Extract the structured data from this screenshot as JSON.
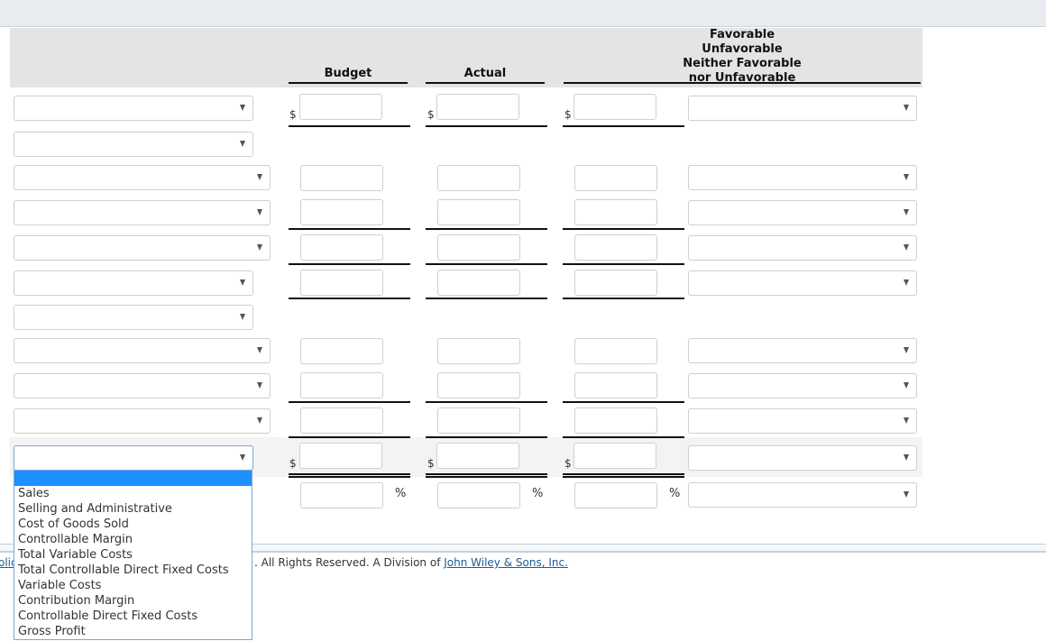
{
  "header": {
    "budget_label": "Budget",
    "actual_label": "Actual",
    "fav_label_lines": [
      "Favorable",
      "Unfavorable",
      "Neither Favorable",
      "nor Unfavorable"
    ]
  },
  "rows": [
    {
      "label_select": "",
      "has_dollar": true,
      "has_amounts": true,
      "fav_select": ""
    },
    {
      "label_select": "",
      "has_dollar": false,
      "has_amounts": false
    },
    {
      "label_select": "",
      "has_dollar": false,
      "has_amounts": true,
      "fav_select": ""
    },
    {
      "label_select": "",
      "has_dollar": false,
      "has_amounts": true,
      "fav_select": ""
    },
    {
      "label_select": "",
      "has_dollar": false,
      "has_amounts": true,
      "fav_select": ""
    },
    {
      "label_select": "",
      "has_dollar": false,
      "has_amounts": true,
      "fav_select": ""
    },
    {
      "label_select": "",
      "has_dollar": false,
      "has_amounts": false
    },
    {
      "label_select": "",
      "has_dollar": false,
      "has_amounts": true,
      "fav_select": ""
    },
    {
      "label_select": "",
      "has_dollar": false,
      "has_amounts": true,
      "fav_select": ""
    },
    {
      "label_select": "",
      "has_dollar": false,
      "has_amounts": true,
      "fav_select": ""
    },
    {
      "label_select": "",
      "has_dollar": true,
      "has_amounts": true,
      "fav_select": "",
      "focused": true
    },
    {
      "has_percent": true,
      "fav_select": ""
    }
  ],
  "symbols": {
    "dollar": "$",
    "percent": "%"
  },
  "dropdown": {
    "options": [
      "",
      "Sales",
      "Selling and Administrative",
      "Cost of Goods Sold",
      "Controllable Margin",
      "Total Variable Costs",
      "Total Controllable Direct Fixed Costs",
      "Variable Costs",
      "Contribution Margin",
      "Controllable Direct Fixed Costs",
      "Gross Profit"
    ],
    "highlighted_index": 0
  },
  "footer": {
    "left_link_fragment": "olic",
    "text_prefix": ". All Rights Reserved. A Division of ",
    "company_link": "John Wiley & Sons, Inc."
  }
}
